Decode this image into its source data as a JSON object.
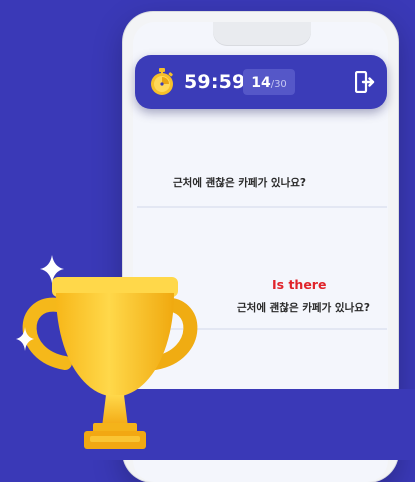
{
  "header": {
    "timer": "59:59",
    "counter_current": "14",
    "counter_sep": "/",
    "counter_total": "30"
  },
  "content": {
    "question_1": "근처에 괜찮은 카페가 있나요?",
    "answer_en": "Is there",
    "question_2": "근처에 괜찮은 카페가 있나요?"
  },
  "icons": {
    "timer": "stopwatch-icon",
    "exit": "exit-icon",
    "trophy": "trophy-icon",
    "sparkle": "sparkle-icon"
  },
  "colors": {
    "background": "#3a39b7",
    "header": "#3b3cb8",
    "accent_red": "#e0242b",
    "trophy_gold": "#f6c02a"
  }
}
